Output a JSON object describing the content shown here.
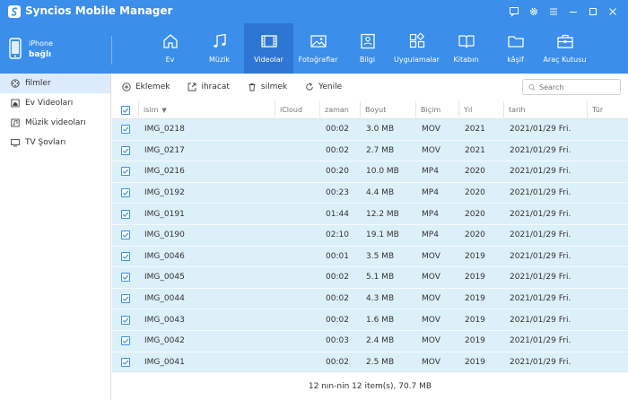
{
  "app": {
    "title": "Syncios Mobile Manager",
    "accent": "#3b8eea"
  },
  "device": {
    "name": "iPhone",
    "status": "bağlı"
  },
  "nav": [
    {
      "label": "Ev",
      "icon": "home-icon"
    },
    {
      "label": "Müzik",
      "icon": "music-icon"
    },
    {
      "label": "Videolar",
      "icon": "video-icon",
      "active": true
    },
    {
      "label": "Fotoğraflar",
      "icon": "photo-icon"
    },
    {
      "label": "Bilgi",
      "icon": "contact-card-icon"
    },
    {
      "label": "Uygulamalar",
      "icon": "apps-icon"
    },
    {
      "label": "Kitabın",
      "icon": "book-icon"
    },
    {
      "label": "kâşif",
      "icon": "folder-icon"
    },
    {
      "label": "Araç Kutusu",
      "icon": "toolbox-icon"
    }
  ],
  "sidebar": {
    "items": [
      {
        "label": "filmler",
        "icon": "film-reel-icon"
      },
      {
        "label": "Ev Videoları",
        "icon": "home-video-icon"
      },
      {
        "label": "Müzik videoları",
        "icon": "music-video-icon"
      },
      {
        "label": "TV Şovları",
        "icon": "tv-icon"
      }
    ]
  },
  "toolbar": {
    "add": "Eklemek",
    "export": "ihracat",
    "delete": "silmek",
    "refresh": "Yenile",
    "search_placeholder": "Search"
  },
  "table": {
    "columns": {
      "name": "isim",
      "icloud": "iCloud",
      "time": "zaman",
      "size": "Boyut",
      "format": "Biçim",
      "year": "Yıl",
      "date": "tarih",
      "type": "Tür"
    },
    "rows": [
      {
        "name": "IMG_0218",
        "time": "00:02",
        "size": "3.0 MB",
        "format": "MOV",
        "year": "2021",
        "date": "2021/01/29 Fri."
      },
      {
        "name": "IMG_0217",
        "time": "00:02",
        "size": "2.7 MB",
        "format": "MOV",
        "year": "2021",
        "date": "2021/01/29 Fri."
      },
      {
        "name": "IMG_0216",
        "time": "00:20",
        "size": "10.0 MB",
        "format": "MP4",
        "year": "2020",
        "date": "2021/01/29 Fri."
      },
      {
        "name": "IMG_0192",
        "time": "00:23",
        "size": "4.4 MB",
        "format": "MP4",
        "year": "2020",
        "date": "2021/01/29 Fri."
      },
      {
        "name": "IMG_0191",
        "time": "01:44",
        "size": "12.2 MB",
        "format": "MP4",
        "year": "2020",
        "date": "2021/01/29 Fri."
      },
      {
        "name": "IMG_0190",
        "time": "02:10",
        "size": "19.1 MB",
        "format": "MP4",
        "year": "2020",
        "date": "2021/01/29 Fri."
      },
      {
        "name": "IMG_0046",
        "time": "00:01",
        "size": "3.5 MB",
        "format": "MOV",
        "year": "2019",
        "date": "2021/01/29 Fri."
      },
      {
        "name": "IMG_0045",
        "time": "00:02",
        "size": "5.1 MB",
        "format": "MOV",
        "year": "2019",
        "date": "2021/01/29 Fri."
      },
      {
        "name": "IMG_0044",
        "time": "00:02",
        "size": "4.3 MB",
        "format": "MOV",
        "year": "2019",
        "date": "2021/01/29 Fri."
      },
      {
        "name": "IMG_0043",
        "time": "00:02",
        "size": "1.6 MB",
        "format": "MOV",
        "year": "2019",
        "date": "2021/01/29 Fri."
      },
      {
        "name": "IMG_0042",
        "time": "00:03",
        "size": "2.4 MB",
        "format": "MOV",
        "year": "2019",
        "date": "2021/01/29 Fri."
      },
      {
        "name": "IMG_0041",
        "time": "00:02",
        "size": "2.5 MB",
        "format": "MOV",
        "year": "2019",
        "date": "2021/01/29 Fri."
      }
    ]
  },
  "status": {
    "text": "12 nın-nin 12 item(s), 70.7 MB"
  }
}
